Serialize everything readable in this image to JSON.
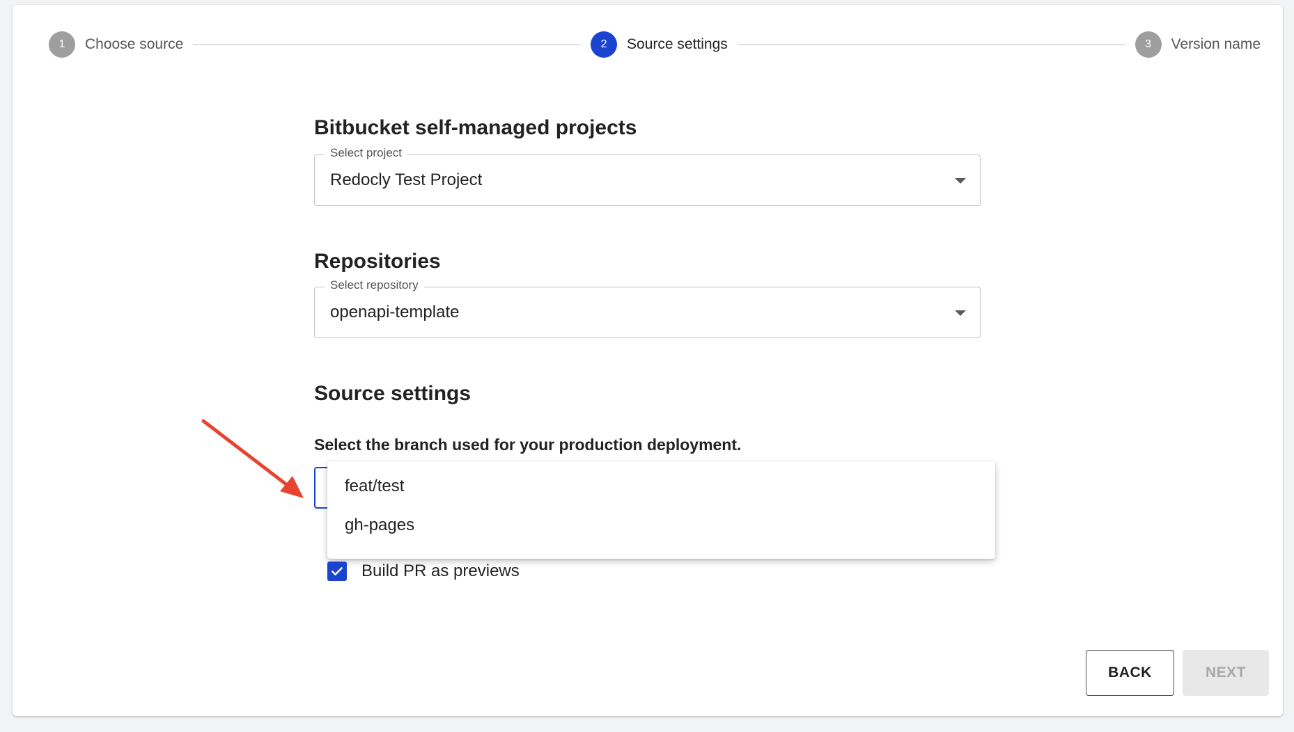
{
  "stepper": {
    "steps": [
      {
        "number": "1",
        "label": "Choose source"
      },
      {
        "number": "2",
        "label": "Source settings"
      },
      {
        "number": "3",
        "label": "Version name"
      }
    ],
    "active_step": 2
  },
  "project_section": {
    "title": "Bitbucket self-managed projects",
    "select_label": "Select project",
    "selected_value": "Redocly Test Project"
  },
  "repository_section": {
    "title": "Repositories",
    "select_label": "Select repository",
    "selected_value": "openapi-template"
  },
  "source_settings": {
    "title": "Source settings",
    "branch_help": "Select the branch used for your production deployment.",
    "branch_options": [
      "feat/test",
      "gh-pages"
    ],
    "build_pr_label": "Build PR as previews",
    "build_pr_checked": true
  },
  "actions": {
    "back_label": "BACK",
    "next_label": "NEXT",
    "next_disabled": true
  },
  "colors": {
    "accent": "#1a44cf",
    "annotation_arrow": "#e8432e",
    "step_inactive": "#9e9e9e"
  },
  "icons": {
    "dropdown_arrow": "caret-down-icon",
    "checkbox": "check-icon"
  }
}
